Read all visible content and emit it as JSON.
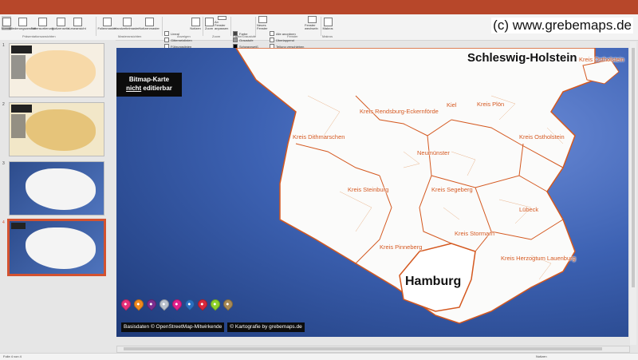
{
  "watermark": "(c) www.grebemaps.de",
  "ribbon": {
    "buttons": [
      "Normal",
      "Gliederungsansicht",
      "Foliensortierung",
      "Notizenseite",
      "Leseansicht",
      "Folienmaster",
      "Handzettelmaster",
      "Notizenmaster",
      "Notizen",
      "Zoom",
      "An Fenster anpassen",
      "Neues Fenster",
      "Fenster wechseln",
      "Makros"
    ],
    "checkboxes": [
      "Lineal",
      "Gitternetzlinien",
      "Führungslinien"
    ],
    "color_options": [
      "Farbe",
      "Graustufe",
      "Schwarzweiß"
    ],
    "window_options": [
      "Alle anordnen",
      "Überlappend",
      "Teilung verschieben"
    ],
    "groups": [
      "Präsentationsansichten",
      "Masteransichten",
      "Anzeigen",
      "Zoom",
      "Farbe/Graustufe",
      "Fenster",
      "Makros"
    ]
  },
  "slides_panel": {
    "numbers": [
      "1",
      "2",
      "3",
      "4"
    ],
    "selected": 4
  },
  "slide": {
    "title": "Schleswig-Holstein",
    "badge_line1": "Bitmap-Karte",
    "badge_line2_u": "nicht",
    "badge_line2_rest": " editierbar",
    "city": "Hamburg",
    "regions": [
      "Kreis Ostholstein",
      "Kreis Rendsburg-Eckernförde",
      "Kiel",
      "Kreis Plön",
      "Kreis Dithmarschen",
      "Neumünster",
      "Kreis Ostholstein",
      "Kreis Steinburg",
      "Kreis Segeberg",
      "Lübeck",
      "Kreis Stormarn",
      "Kreis Pinneberg",
      "Kreis Herzogtum Lauenburg"
    ],
    "credit_left": "Basisdaten © OpenStreetMap-Mitwirkende",
    "credit_right": "© Kartografie by grebemaps.de",
    "pin_colors": [
      "#e8317a",
      "#f08a1d",
      "#7b2e8f",
      "#b8c0cc",
      "#e2208c",
      "#2b6fc0",
      "#d8283c",
      "#8fd12a",
      "#a88a55"
    ]
  },
  "statusbar": {
    "slide_info": "Folie 4 von 4",
    "notes": "Notizen"
  },
  "colors": {
    "accent": "#b7472a",
    "district_border": "#d4581f"
  }
}
